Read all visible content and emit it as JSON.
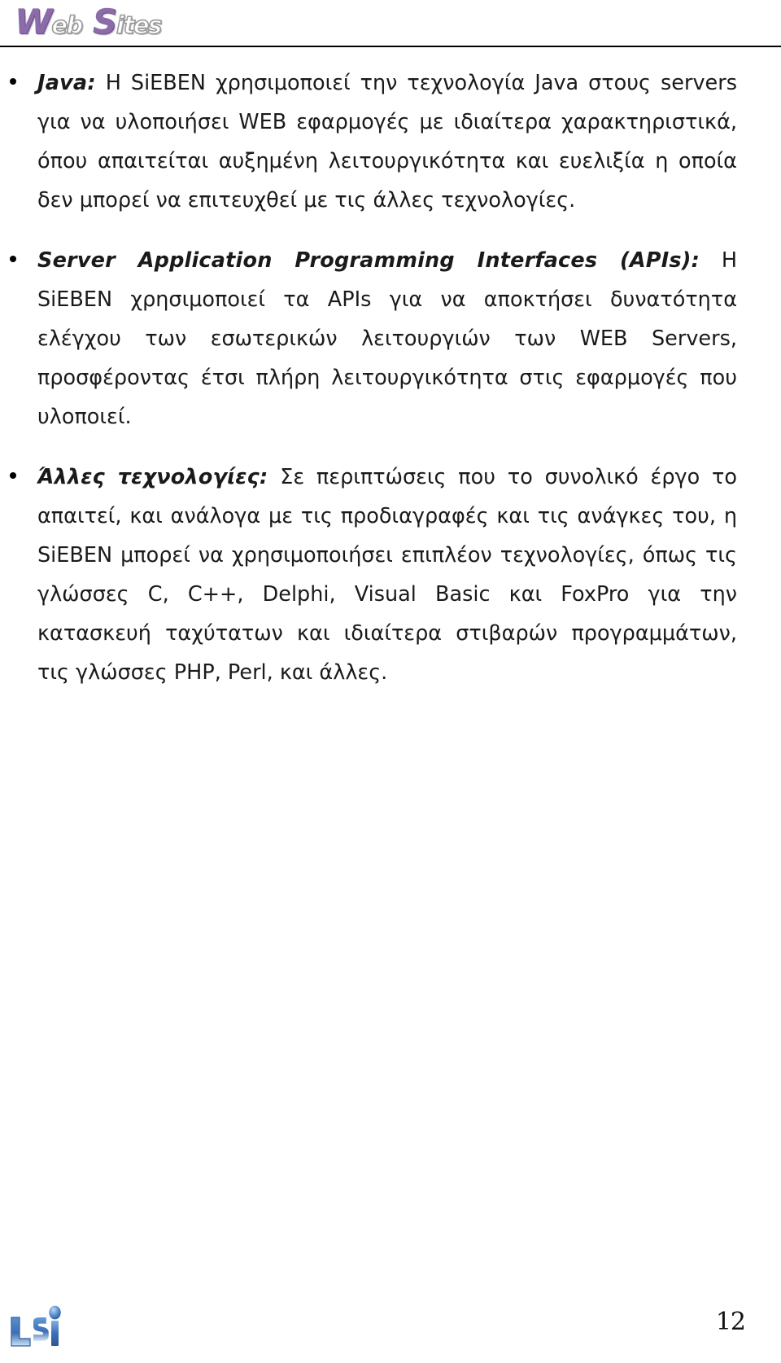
{
  "header": {
    "logo": {
      "icon": "wordart-web-sites-logo",
      "word1_cap": "W",
      "word1_low": "eb",
      "word2_cap": "S",
      "word2_low": "ites",
      "full_text": "Web Sites",
      "cap_color": "#8B6BA8",
      "low_color": "#9a9a9a"
    },
    "rule_color": "#000000"
  },
  "content": {
    "bullets": [
      {
        "lead": "Java:",
        "text": " Η SiEBEN χρησιμοποιεί την τεχνολογία Java στους servers για να υλοποιήσει WEB εφαρμογές με ιδιαίτερα χαρακτηριστικά, όπου απαιτείται αυξημένη λειτουργικότητα και ευελιξία η οποία δεν μπορεί να επιτευχθεί με τις άλλες τεχνολογίες."
      },
      {
        "lead": "Server Application Programming Interfaces (APIs):",
        "text": " Η SiEBEN χρησιμοποιεί τα APIs για να αποκτήσει δυνατότητα ελέγχου των εσωτερικών λειτουργιών των WEB Servers, προσφέροντας έτσι πλήρη λειτουργικότητα στις εφαρμογές που υλοποιεί."
      },
      {
        "lead": "Άλλες τεχνολογίες:",
        "text": " Σε περιπτώσεις που το συνολικό έργο το απαιτεί, και ανάλογα με τις προδιαγραφές και τις ανάγκες του, η SiEBEN μπορεί να χρησιμοποιήσει επιπλέον τεχνολογίες, όπως τις γλώσσες C, C++, Delphi, Visual Basic και FoxPro για την κατασκευή ταχύτατων και ιδιαίτερα στιβαρών προγραμμάτων, τις γλώσσες PHP, Perl, και άλλες."
      }
    ]
  },
  "footer": {
    "logo": {
      "icon": "lsi-logo",
      "text": "LSi",
      "color": "#3C6FB4"
    },
    "page_number": "12"
  }
}
